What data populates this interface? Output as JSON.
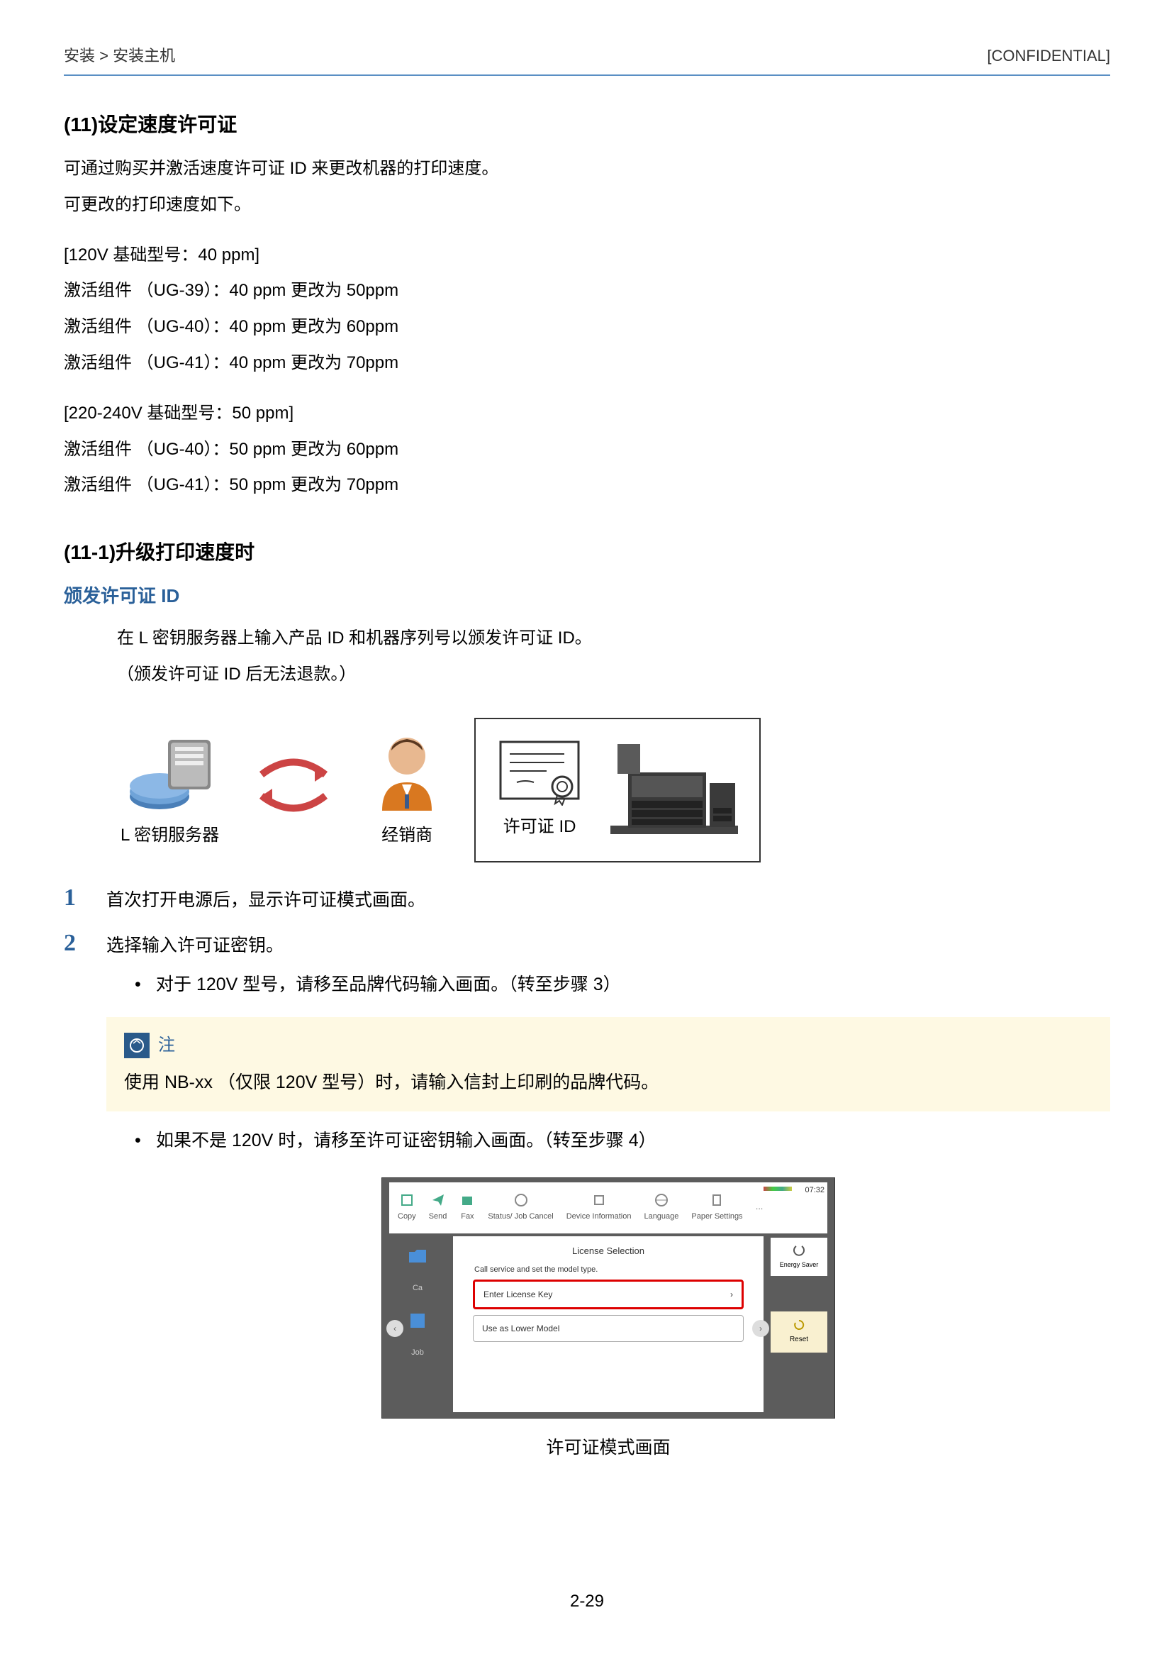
{
  "header": {
    "breadcrumb": "安装 > 安装主机",
    "confidential": "[CONFIDENTIAL]"
  },
  "section11": {
    "title": "(11)设定速度许可证",
    "intro1": "可通过购买并激活速度许可证 ID 来更改机器的打印速度。",
    "intro2": "可更改的打印速度如下。",
    "group1_header": "[120V 基础型号：40 ppm]",
    "group1_lines": [
      "激活组件 （UG-39）：40 ppm 更改为 50ppm",
      "激活组件 （UG-40）：40 ppm 更改为 60ppm",
      "激活组件 （UG-41）：40 ppm 更改为 70ppm"
    ],
    "group2_header": "[220-240V 基础型号：50 ppm]",
    "group2_lines": [
      "激活组件 （UG-40）：50 ppm 更改为 60ppm",
      "激活组件 （UG-41）：50 ppm 更改为 70ppm"
    ]
  },
  "section11_1": {
    "title": "(11-1)升级打印速度时",
    "blue_heading": "颁发许可证 ID",
    "indent1": "在 L 密钥服务器上输入产品 ID 和机器序列号以颁发许可证 ID。",
    "indent2": "（颁发许可证 ID 后无法退款。）"
  },
  "diagram": {
    "server_label": "L 密钥服务器",
    "dealer_label": "经销商",
    "license_label": "许可证 ID"
  },
  "steps": {
    "s1_num": "1",
    "s1_text": "首次打开电源后，显示许可证模式画面。",
    "s2_num": "2",
    "s2_text": "选择输入许可证密钥。",
    "s2_bullet1": "对于 120V 型号，请移至品牌代码输入画面。（转至步骤 3）",
    "s2_bullet2": "如果不是 120V 时，请移至许可证密钥输入画面。（转至步骤 4）"
  },
  "note": {
    "label": "注",
    "text": "使用 NB-xx （仅限 120V 型号）时，请输入信封上印刷的品牌代码。"
  },
  "screenshot": {
    "time": "07:32",
    "toolbar": [
      "Copy",
      "Send",
      "Fax",
      "Status/ Job Cancel",
      "Device Information",
      "Language",
      "Paper Settings",
      "…"
    ],
    "panel_title": "License Selection",
    "panel_sub": "Call service and set the model type.",
    "btn_enter": "Enter License Key",
    "btn_lower": "Use as Lower Model",
    "energy": "Energy Saver",
    "reset": "Reset",
    "side_left": [
      "Ca",
      "Job"
    ],
    "caption": "许可证模式画面"
  },
  "page_num": "2-29"
}
